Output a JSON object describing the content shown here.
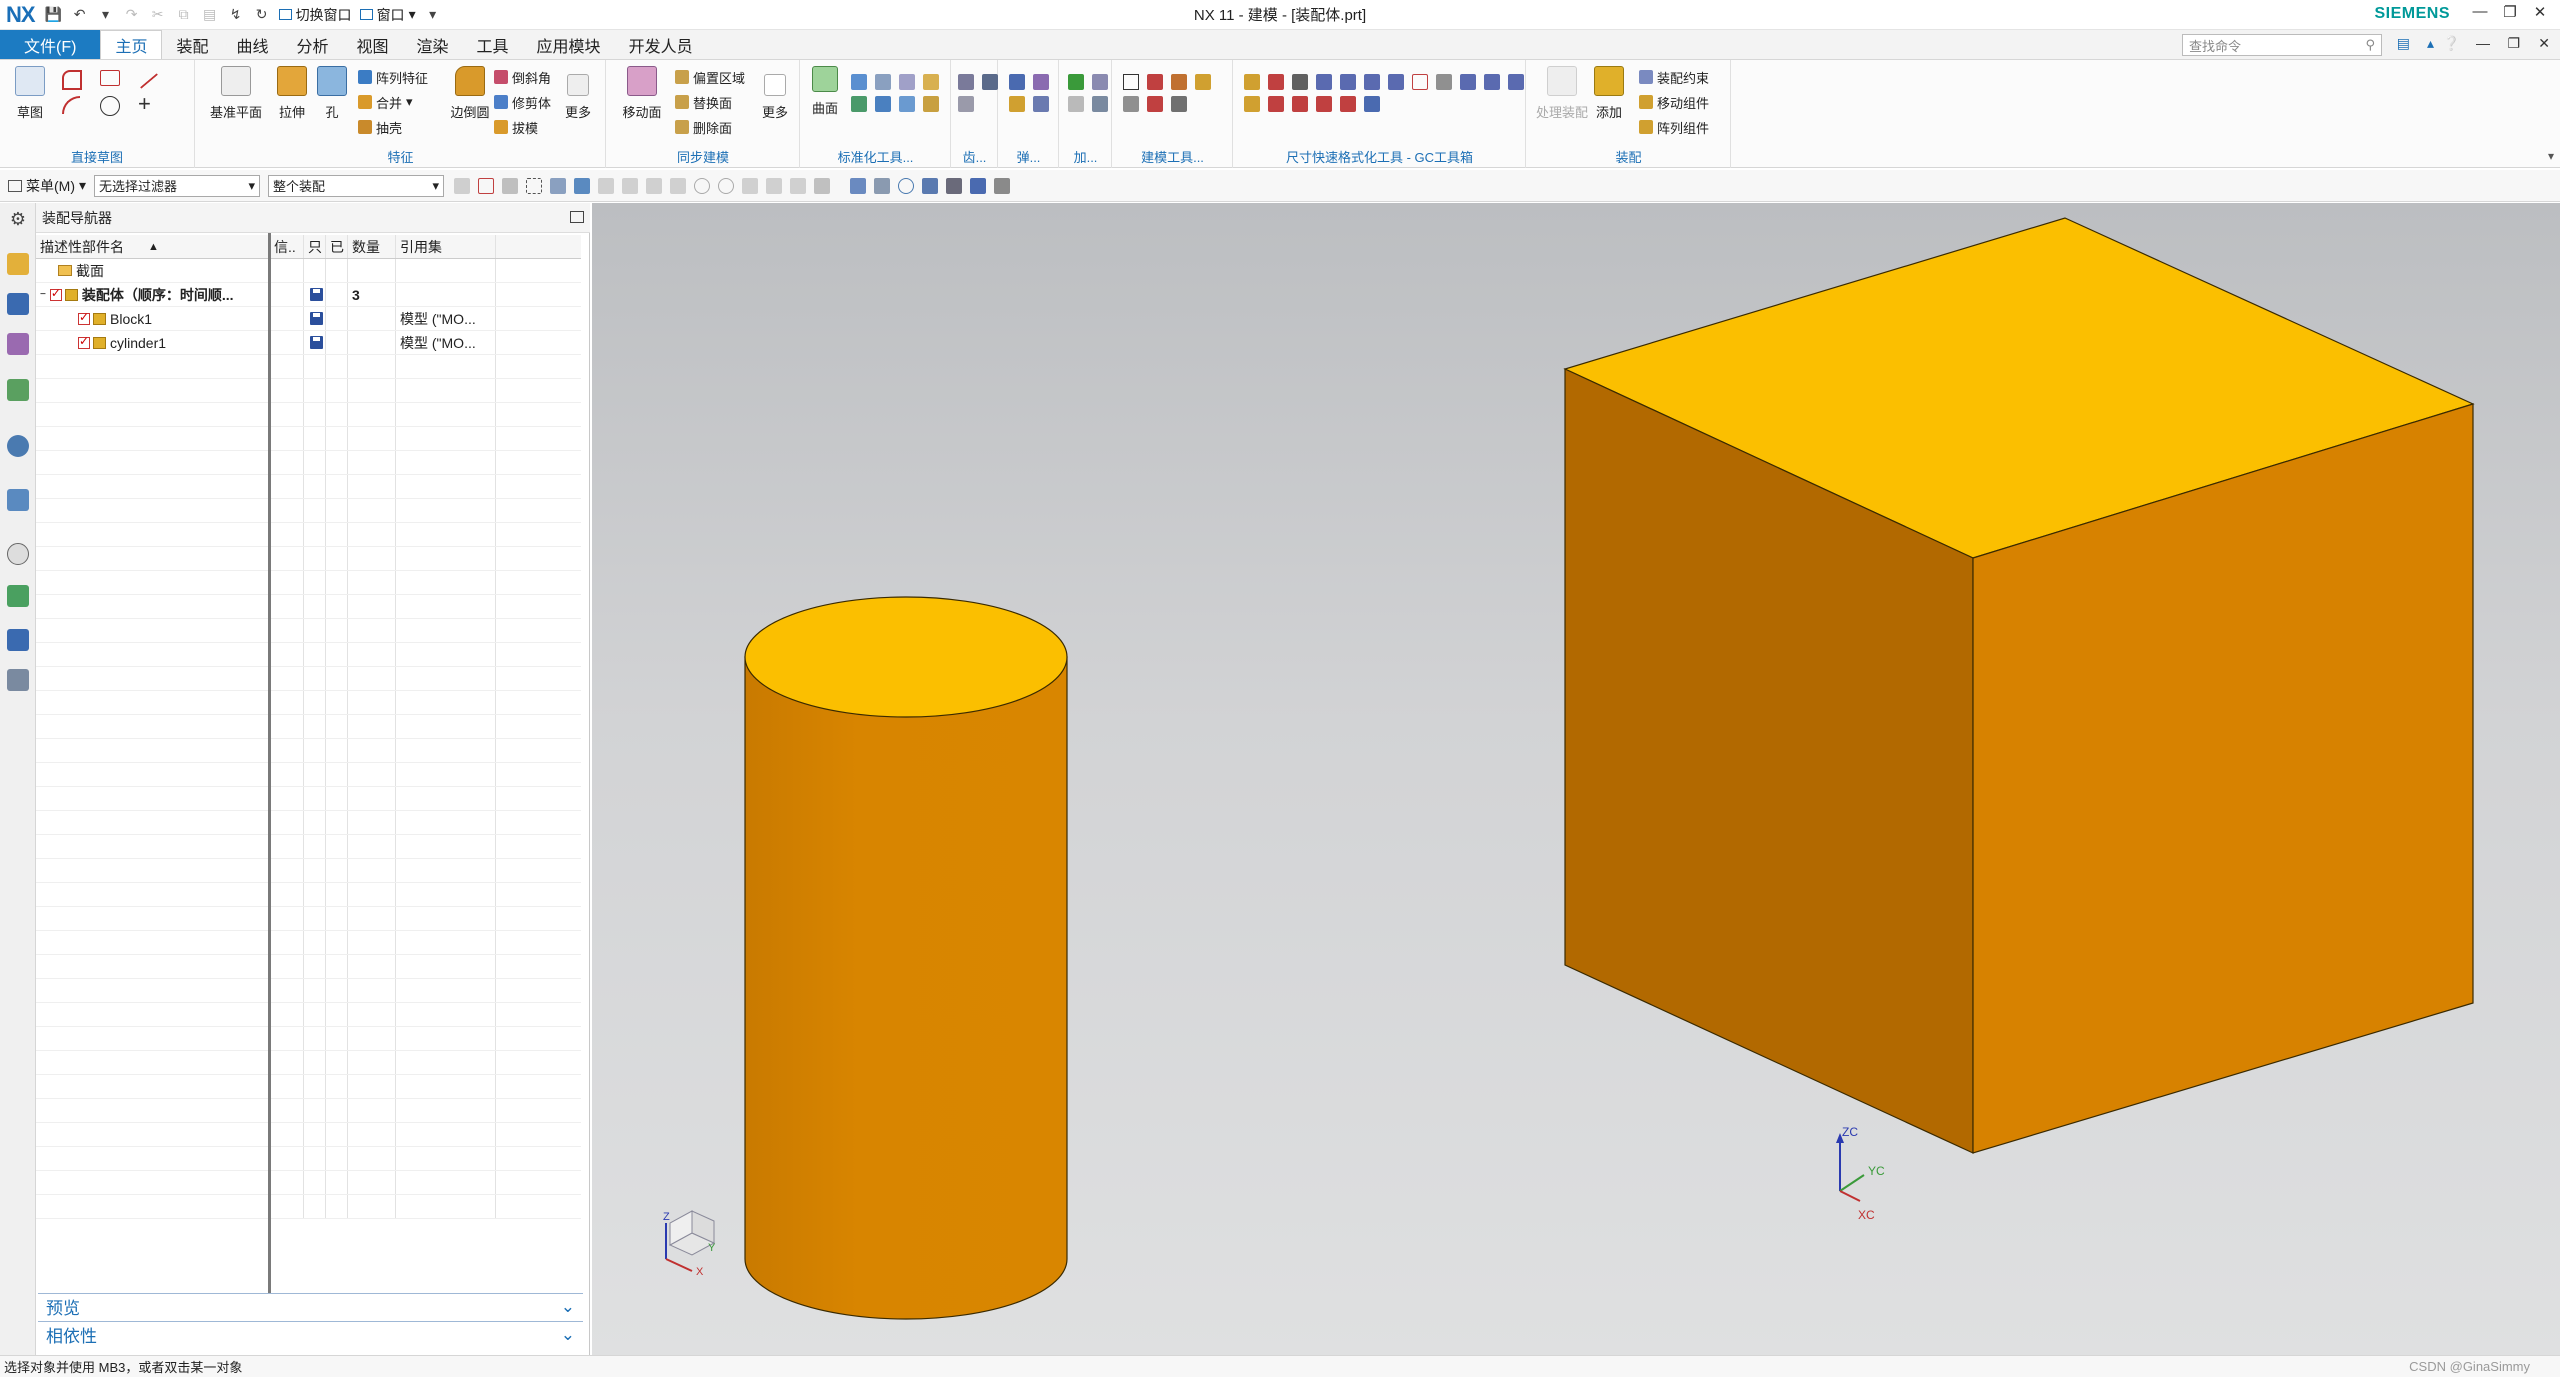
{
  "titlebar": {
    "logo": "NX",
    "switch_window": "切换窗口",
    "window_menu": "窗口",
    "title": "NX 11 - 建模 - [装配体.prt]",
    "brand": "SIEMENS"
  },
  "menubar": {
    "file": "文件(F)",
    "tabs": [
      "主页",
      "装配",
      "曲线",
      "分析",
      "视图",
      "渲染",
      "工具",
      "应用模块",
      "开发人员"
    ],
    "active_tab": "主页",
    "search_placeholder": "查找命令"
  },
  "ribbon": {
    "sketch": {
      "label": "草图",
      "group": "直接草图"
    },
    "feature": {
      "datum_plane": "基准平面",
      "extrude": "拉伸",
      "hole": "孔",
      "pattern_feature": "阵列特征",
      "unite": "合并",
      "shell": "抽壳",
      "edge_blend": "边倒圆",
      "chamfer": "倒斜角",
      "trim_body": "修剪体",
      "draft": "拔模",
      "more": "更多",
      "group": "特征"
    },
    "sync": {
      "move_face": "移动面",
      "offset_region": "偏置区域",
      "replace_face": "替换面",
      "delete_face": "删除面",
      "more": "更多",
      "group": "同步建模"
    },
    "surface": {
      "label": "曲面"
    },
    "groups": {
      "standard_tools": "标准化工具...",
      "gear": "齿...",
      "spring": "弹...",
      "machining": "加...",
      "modeling_tools": "建模工具...",
      "dimension_tools": "尺寸快速格式化工具 - GC工具箱",
      "assembly": "装配"
    },
    "assembly": {
      "process_assembly": "处理装配",
      "add": "添加",
      "assembly_constraints": "装配约束",
      "move_component": "移动组件",
      "pattern_component": "阵列组件"
    }
  },
  "selbar": {
    "menu": "菜单(M)",
    "filter": "无选择过滤器",
    "scope": "整个装配"
  },
  "navigator": {
    "title": "装配导航器",
    "columns": [
      "描述性部件名",
      "信..",
      "只",
      "已",
      "数量",
      "引用集"
    ],
    "rows": [
      {
        "name": "截面",
        "qty": "",
        "refset": ""
      },
      {
        "name": "装配体（顺序：时间顺...",
        "qty": "3",
        "refset": ""
      },
      {
        "name": "Block1",
        "qty": "",
        "refset": "模型 (\"MO..."
      },
      {
        "name": "cylinder1",
        "qty": "",
        "refset": "模型 (\"MO..."
      }
    ],
    "panels": [
      "预览",
      "相依性"
    ]
  },
  "viewport": {
    "colors": {
      "top": "#fbbf00",
      "side_light": "#d78200",
      "side_dark": "#b26900",
      "edge": "#2a2000"
    },
    "triad": {
      "x": "XC",
      "y": "YC",
      "z": "ZC"
    },
    "mini_triad": {
      "x": "X",
      "y": "Y",
      "z": "Z"
    }
  },
  "statusbar": {
    "message": "选择对象并使用 MB3，或者双击某一对象",
    "watermark": "CSDN @GinaSimmy"
  }
}
